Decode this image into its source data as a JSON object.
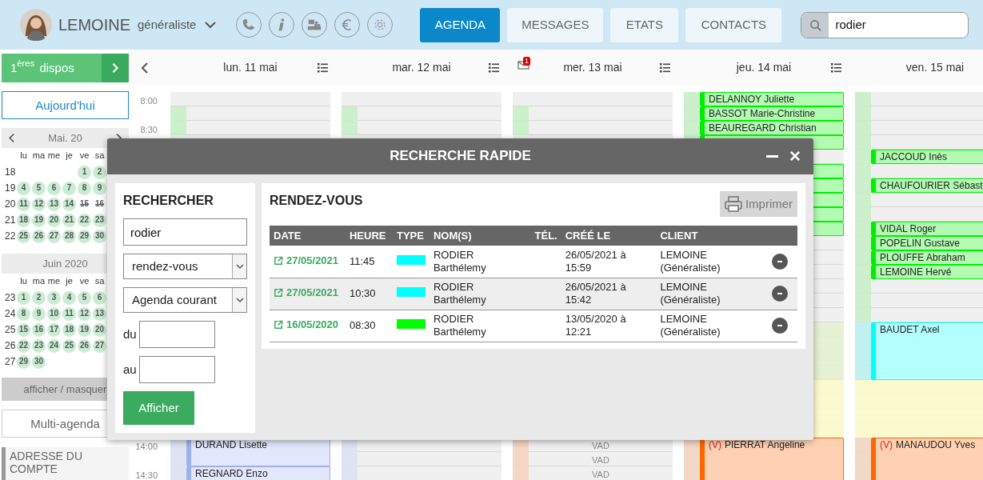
{
  "header": {
    "user_name": "LEMOINE",
    "user_role": "généraliste",
    "tabs": [
      {
        "label": "AGENDA",
        "selected": true
      },
      {
        "label": "MESSAGES",
        "selected": false
      },
      {
        "label": "ETATS",
        "selected": false
      },
      {
        "label": "CONTACTS",
        "selected": false
      }
    ],
    "search": {
      "value": "rodier"
    }
  },
  "sidebar": {
    "dispos_button": "1$^{ères}$ dispos",
    "today_button": "Aujourd'hui",
    "mini_calendars": [
      {
        "title": "Mai. 20",
        "nav": true,
        "weekdays": [
          "lu",
          "ma",
          "me",
          "je",
          "ve",
          "sa"
        ],
        "weeks": [
          {
            "number": "18",
            "days": [
              {
                "label": "1",
                "available": true,
                "struck": false
              },
              {
                "label": "2",
                "available": true,
                "struck": false
              }
            ]
          },
          {
            "number": "19",
            "days": [
              {
                "label": "4",
                "available": true,
                "struck": false
              },
              {
                "label": "5",
                "available": true,
                "struck": false
              },
              {
                "label": "6",
                "available": true,
                "struck": false
              },
              {
                "label": "7",
                "available": true,
                "struck": false
              },
              {
                "label": "8",
                "available": true,
                "struck": false
              },
              {
                "label": "9",
                "available": true,
                "struck": false
              }
            ]
          },
          {
            "number": "20",
            "days": [
              {
                "label": "11",
                "available": true,
                "struck": false
              },
              {
                "label": "12",
                "available": true,
                "struck": false
              },
              {
                "label": "13",
                "available": true,
                "struck": false
              },
              {
                "label": "14",
                "available": true,
                "struck": false
              },
              {
                "label": "15",
                "available": false,
                "struck": true
              },
              {
                "label": "16",
                "available": false,
                "struck": true
              }
            ]
          },
          {
            "number": "21",
            "days": [
              {
                "label": "18",
                "available": true,
                "struck": false
              },
              {
                "label": "19",
                "available": true,
                "struck": false
              },
              {
                "label": "20",
                "available": true,
                "struck": false
              },
              {
                "label": "21",
                "available": true,
                "struck": false
              },
              {
                "label": "22",
                "available": true,
                "struck": false
              },
              {
                "label": "23",
                "available": true,
                "struck": false
              }
            ]
          },
          {
            "number": "22",
            "days": [
              {
                "label": "25",
                "available": true,
                "struck": false
              },
              {
                "label": "26",
                "available": true,
                "struck": false
              },
              {
                "label": "27",
                "available": true,
                "struck": false
              },
              {
                "label": "28",
                "available": true,
                "struck": false
              },
              {
                "label": "29",
                "available": true,
                "struck": false
              },
              {
                "label": "30",
                "available": true,
                "struck": false
              }
            ]
          }
        ]
      },
      {
        "title": "Juin 2020",
        "nav": false,
        "weekdays": [
          "lu",
          "ma",
          "me",
          "je",
          "ve",
          "sa"
        ],
        "weeks": [
          {
            "number": "23",
            "days": [
              {
                "label": "1",
                "available": true,
                "struck": false
              },
              {
                "label": "2",
                "available": true,
                "struck": false
              },
              {
                "label": "3",
                "available": true,
                "struck": false
              },
              {
                "label": "4",
                "available": true,
                "struck": false
              },
              {
                "label": "5",
                "available": true,
                "struck": false
              },
              {
                "label": "6",
                "available": true,
                "struck": false
              }
            ]
          },
          {
            "number": "24",
            "days": [
              {
                "label": "8",
                "available": true,
                "struck": false
              },
              {
                "label": "9",
                "available": true,
                "struck": false
              },
              {
                "label": "10",
                "available": true,
                "struck": false
              },
              {
                "label": "11",
                "available": true,
                "struck": false
              },
              {
                "label": "12",
                "available": true,
                "struck": false
              },
              {
                "label": "13",
                "available": true,
                "struck": false
              }
            ]
          },
          {
            "number": "25",
            "days": [
              {
                "label": "15",
                "available": true,
                "struck": false
              },
              {
                "label": "16",
                "available": true,
                "struck": false
              },
              {
                "label": "17",
                "available": true,
                "struck": false
              },
              {
                "label": "18",
                "available": true,
                "struck": false
              },
              {
                "label": "19",
                "available": true,
                "struck": false
              },
              {
                "label": "20",
                "available": true,
                "struck": false
              }
            ]
          },
          {
            "number": "26",
            "days": [
              {
                "label": "22",
                "available": true,
                "struck": false
              },
              {
                "label": "23",
                "available": true,
                "struck": false
              },
              {
                "label": "24",
                "available": true,
                "struck": false
              },
              {
                "label": "25",
                "available": true,
                "struck": false
              },
              {
                "label": "26",
                "available": true,
                "struck": false
              },
              {
                "label": "27",
                "available": true,
                "struck": false
              }
            ]
          },
          {
            "number": "27",
            "days": [
              {
                "label": "29",
                "available": true,
                "struck": false
              },
              {
                "label": "30",
                "available": true,
                "struck": false
              }
            ]
          }
        ]
      }
    ],
    "toggle_label": "afficher / masquer",
    "multi_agenda_button": "Multi-agenda",
    "account_section": "ADRESSE DU COMPTE"
  },
  "calendar": {
    "time_labels": [
      "8:00",
      "8:30",
      "14:00",
      "14:30"
    ],
    "days": [
      {
        "label": "lun. 11 mai",
        "list_button": true,
        "appointments": [
          {
            "name": "DURAND Lisette",
            "color": "#9fb0f0"
          },
          {
            "name": "REGNARD Enzo",
            "color": "#9fb0f0"
          }
        ]
      },
      {
        "label": "mar. 12 mai",
        "list_button": true
      },
      {
        "label": "mer. 13 mai",
        "list_button": true,
        "mail_badge": "1",
        "notes": [
          "VAD",
          "VAD",
          "VAD"
        ]
      },
      {
        "label": "jeu. 14 mai",
        "list_button": true,
        "appointments": [
          {
            "name": "DELANNOY Juliette",
            "color": "#00ee00"
          },
          {
            "name": "BASSOT Marie-Christine",
            "color": "#00ee00"
          },
          {
            "name": "BEAUREGARD Christian",
            "color": "#00ee00"
          },
          {
            "color": "#00ee00"
          },
          {
            "color": "#00ee00"
          },
          {
            "color": "#00ee00"
          },
          {
            "color": "#00ee00"
          },
          {
            "color": "#00ee00"
          },
          {
            "color": "#00ee00"
          },
          {
            "name": "PIERRAT Angeline",
            "prefix": "(V)",
            "color": "#ff6600"
          }
        ]
      },
      {
        "label": "ven. 15 mai",
        "list_button": false,
        "appointments": [
          {
            "name": "JACCOUD Inès",
            "color": "#00ee00"
          },
          {
            "name": "CHAUFOURIER Sébast",
            "color": "#00ee00"
          },
          {
            "name": "VIDAL Roger",
            "color": "#00ee00"
          },
          {
            "name": "POPELIN Gustave",
            "color": "#00ee00"
          },
          {
            "name": "PLOUFFE Abraham",
            "color": "#00ee00"
          },
          {
            "name": "LEMOINE Hervé",
            "color": "#00ee00"
          },
          {
            "name": "BAUDET Axel",
            "color": "#00ffff"
          },
          {
            "name": "MANAUDOU Yves",
            "prefix": "(V)",
            "color": "#ff6600"
          }
        ]
      }
    ]
  },
  "modal": {
    "title": "RECHERCHE RAPIDE",
    "search_panel": {
      "heading": "RECHERCHER",
      "query": "rodier",
      "type_select": "rendez-vous",
      "agenda_select": "Agenda courant",
      "from_label": "du",
      "to_label": "au",
      "submit": "Afficher"
    },
    "results": {
      "heading": "RENDEZ-VOUS",
      "print_button": "Imprimer",
      "columns": [
        "DATE",
        "HEURE",
        "TYPE",
        "NOM(S)",
        "TÉL.",
        "CRÉÉ LE",
        "CLIENT"
      ],
      "rows": [
        {
          "date": "27/05/2021",
          "time": "11:45",
          "color": "#00ffff",
          "names": "RODIER Barthélemy",
          "created": "26/05/2021 à 15:59",
          "client": "LEMOINE (Généraliste)"
        },
        {
          "date": "27/05/2021",
          "time": "10:30",
          "color": "#00ffff",
          "names": "RODIER Barthélemy",
          "created": "26/05/2021 à 15:42",
          "client": "LEMOINE (Généraliste)"
        },
        {
          "date": "16/05/2020",
          "time": "08:30",
          "color": "#00ff00",
          "names": "RODIER Barthélemy",
          "created": "13/05/2020 à 12:21",
          "client": "LEMOINE (Généraliste)"
        }
      ]
    }
  }
}
